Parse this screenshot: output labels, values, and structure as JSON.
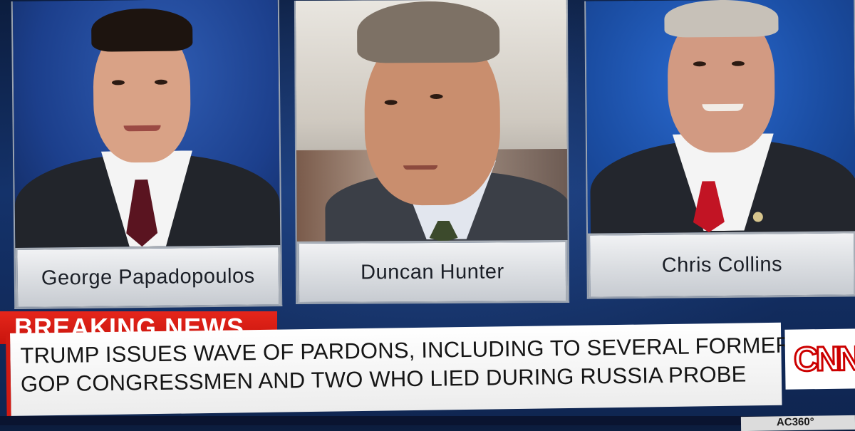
{
  "panels": [
    {
      "name": "George Papadopoulos"
    },
    {
      "name": "Duncan Hunter"
    },
    {
      "name": "Chris Collins"
    }
  ],
  "lower_third": {
    "banner": "BREAKING NEWS",
    "headline_line1": "TRUMP ISSUES WAVE OF PARDONS, INCLUDING TO SEVERAL FORMER",
    "headline_line2": "GOP CONGRESSMEN AND TWO WHO LIED DURING RUSSIA PROBE"
  },
  "network": {
    "logo_text": "CNN",
    "show_bug": "AC360°"
  },
  "colors": {
    "breaking_red": "#d11a12",
    "background_blue": "#14326a",
    "nameplate_silver": "#d9dce0"
  }
}
